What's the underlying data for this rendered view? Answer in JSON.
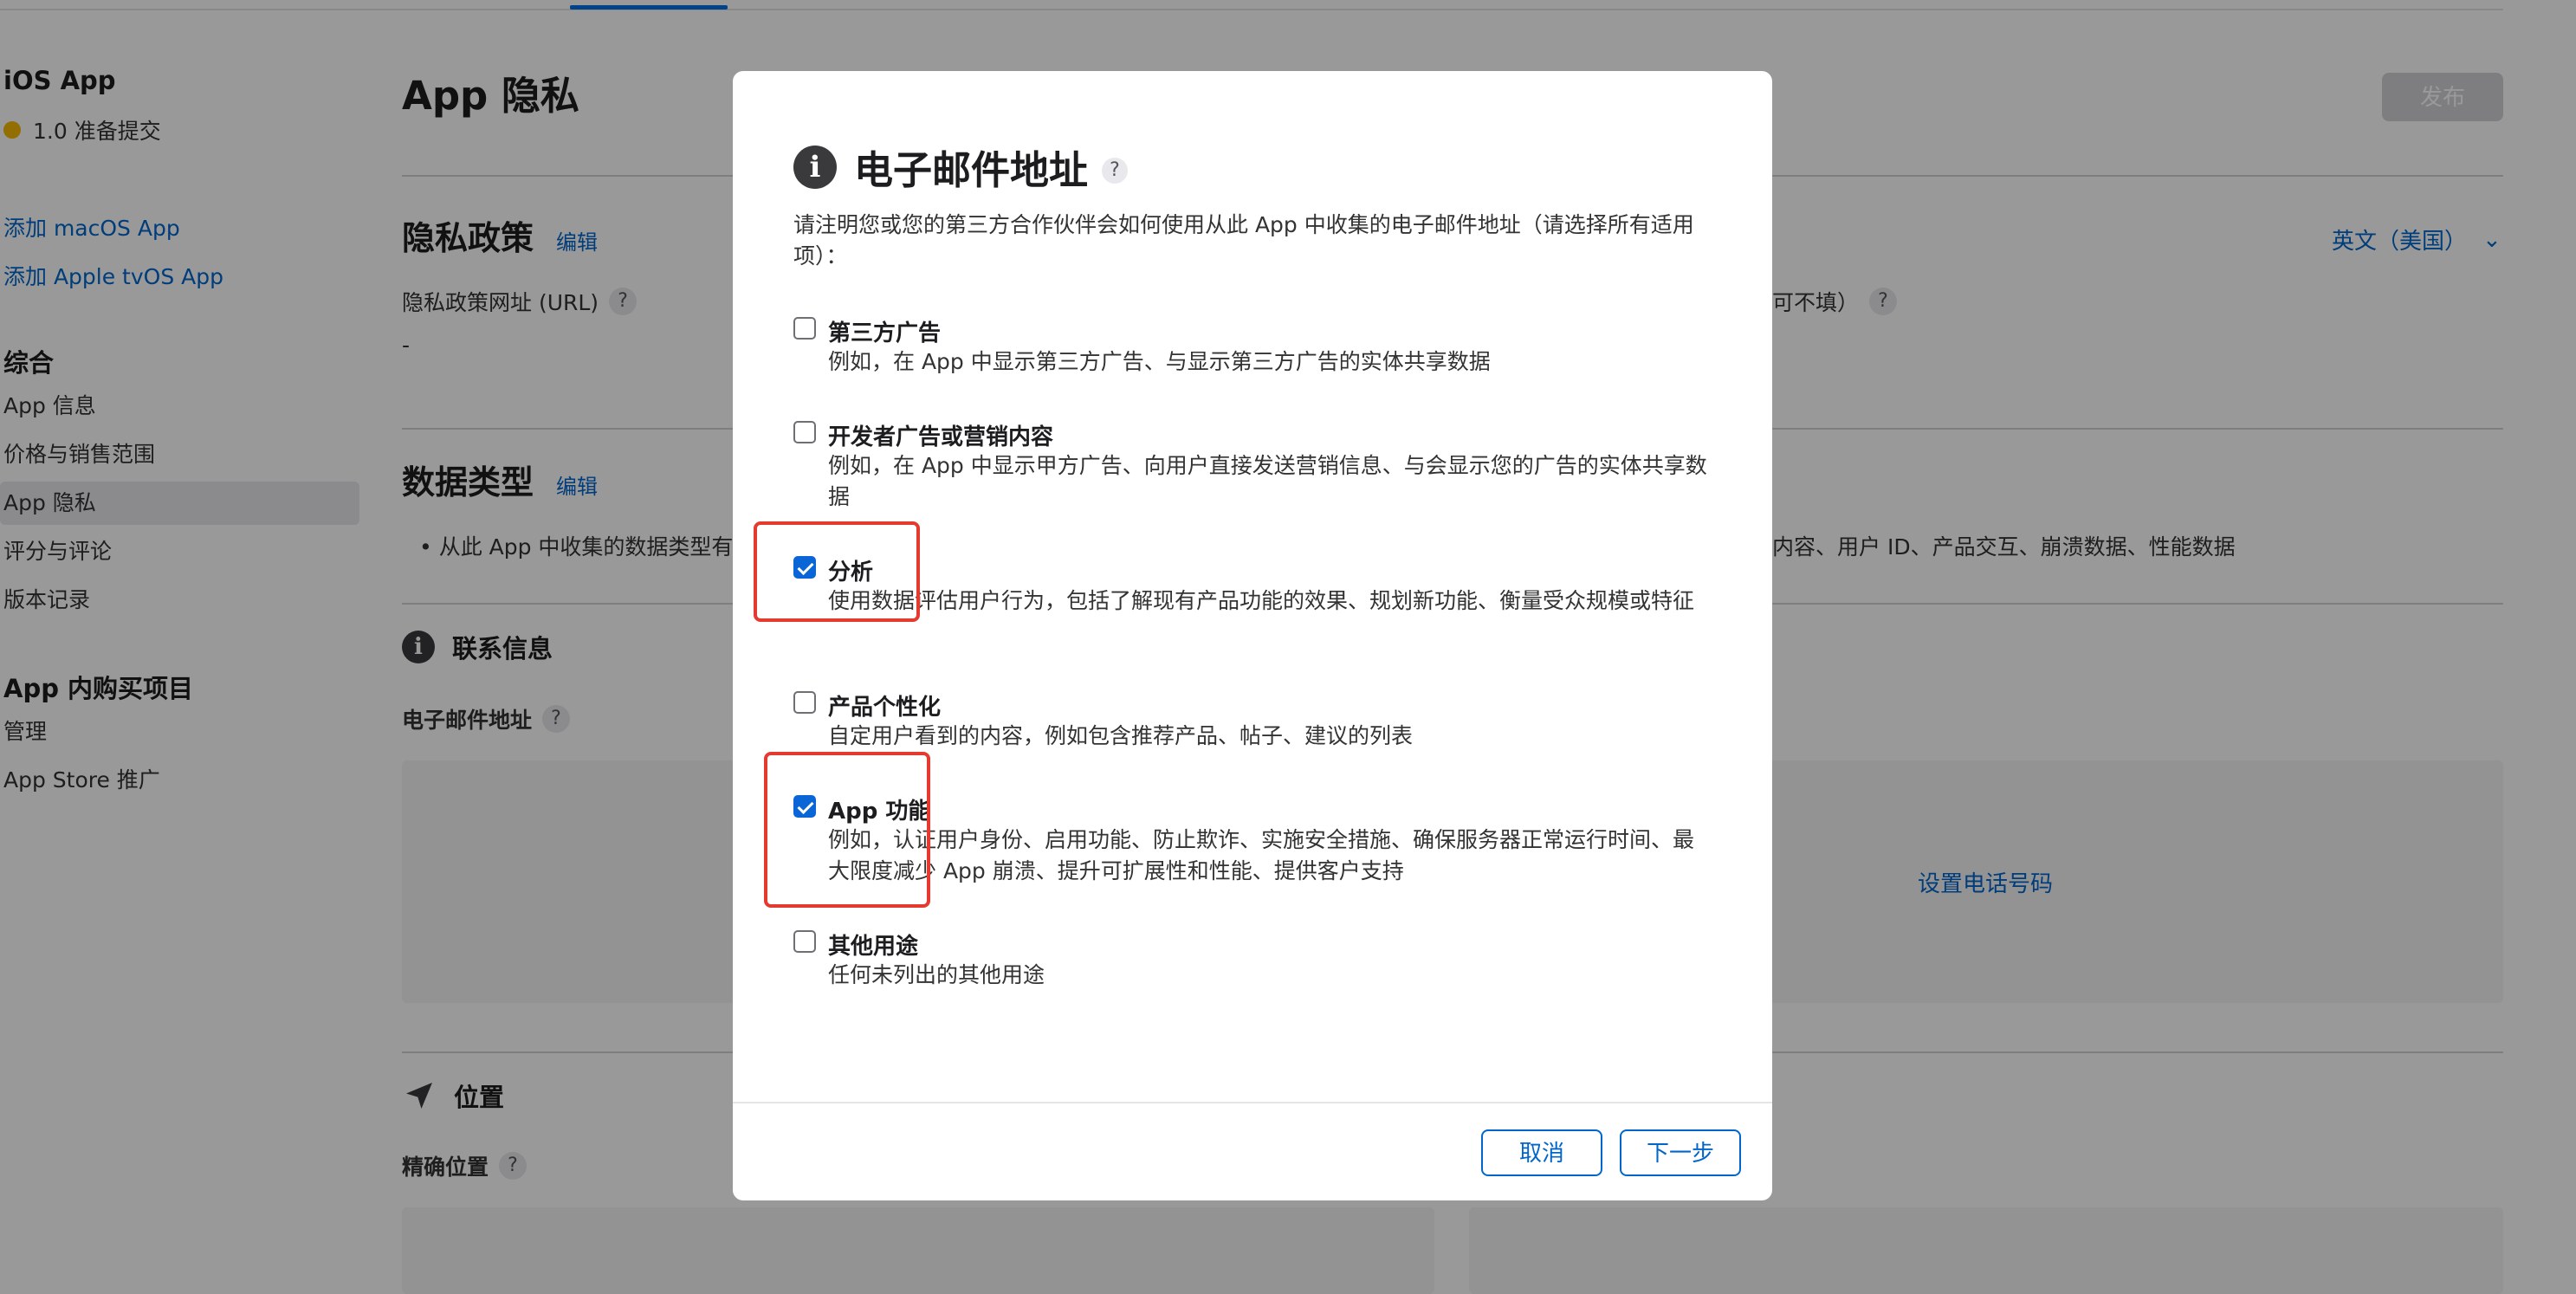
{
  "sidebar": {
    "app_title": "iOS App",
    "version_status": "1.0 准备提交",
    "add_macos": "添加 macOS App",
    "add_tvos": "添加 Apple tvOS App",
    "general_head": "综合",
    "items": [
      "App 信息",
      "价格与销售范围",
      "App 隐私",
      "评分与评论",
      "版本记录"
    ],
    "iap_head": "App 内购买项目",
    "iap_items": [
      "管理",
      "App Store 推广"
    ]
  },
  "main": {
    "page_title": "App 隐私",
    "publish_label": "发布",
    "privacy_policy_title": "隐私政策",
    "edit_label": "编辑",
    "policy_url_label": "隐私政策网址 (URL)",
    "policy_url_value": "-",
    "optional_suffix": "可不填）",
    "language": "英文（美国）",
    "data_types_title": "数据类型",
    "data_types_bullet": "• 从此 App 中收集的数据类型有",
    "data_types_tail": "内容、用户 ID、产品交互、崩溃数据、性能数据",
    "contact_head": "联系信息",
    "email_label": "电子邮件地址",
    "set_phone": "设置电话号码",
    "location_head": "位置",
    "precise_location": "精确位置",
    "help_glyph": "?"
  },
  "modal": {
    "title": "电子邮件地址",
    "help_glyph": "?",
    "description": "请注明您或您的第三方合作伙伴会如何使用从此 App 中收集的电子邮件地址（请选择所有适用项）：",
    "options": [
      {
        "label": "第三方广告",
        "desc": "例如，在 App 中显示第三方广告、与显示第三方广告的实体共享数据",
        "checked": false
      },
      {
        "label": "开发者广告或营销内容",
        "desc": "例如，在 App 中显示甲方广告、向用户直接发送营销信息、与会显示您的广告的实体共享数据",
        "checked": false
      },
      {
        "label": "分析",
        "desc": "使用数据评估用户行为，包括了解现有产品功能的效果、规划新功能、衡量受众规模或特征",
        "checked": true
      },
      {
        "label": "产品个性化",
        "desc": "自定用户看到的内容，例如包含推荐产品、帖子、建议的列表",
        "checked": false
      },
      {
        "label": "App 功能",
        "desc": "例如，认证用户身份、启用功能、防止欺诈、实施安全措施、确保服务器正常运行时间、最大限度减少 App 崩溃、提升可扩展性和性能、提供客户支持",
        "checked": true
      },
      {
        "label": "其他用途",
        "desc": "任何未列出的其他用途",
        "checked": false
      }
    ],
    "cancel_label": "取消",
    "next_label": "下一步"
  },
  "colors": {
    "accent": "#0066cc",
    "highlight": "#e53a2f",
    "checkbox_on": "#0a66d6"
  }
}
